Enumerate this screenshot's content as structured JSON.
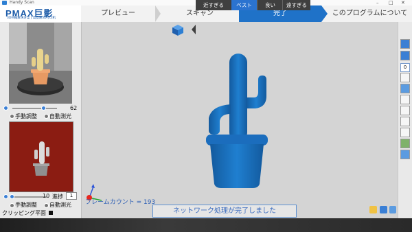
{
  "window": {
    "title": "Handy Scan"
  },
  "brand": {
    "logo": "PMAX巨影",
    "tagline": "3D扫描解决方案 | 高品质3D打印机"
  },
  "steps": [
    {
      "label": "プレビュー"
    },
    {
      "label": "スキャン"
    },
    {
      "label": "完了"
    },
    {
      "label": "このプログラムについて"
    }
  ],
  "view_tabs": [
    {
      "label": "近すぎる"
    },
    {
      "label": "ベスト"
    },
    {
      "label": "良い"
    },
    {
      "label": "遠すぎる"
    }
  ],
  "left_panel": {
    "camera1": {
      "slider_value": "62",
      "slider_fraction": 0.68,
      "manual_label": "手動調整",
      "auto_label": "自動測光"
    },
    "camera2": {
      "slider_value": "10",
      "slider_fraction": 0.12,
      "step_label": "進捗",
      "step_value": "1",
      "manual_label": "手動調整",
      "auto_label": "自動測光"
    },
    "clipping_label": "クリッピング平面"
  },
  "right_toolbar": {
    "counter": "0"
  },
  "status": {
    "frame_count": "フレームカウント = 193",
    "message": "ネットワーク処理が完了しました"
  },
  "colors": {
    "accent": "#1f72c8",
    "model": "#1b74c5",
    "brand": "#1a5aa8",
    "camera2_bg": "#8b1c12"
  }
}
